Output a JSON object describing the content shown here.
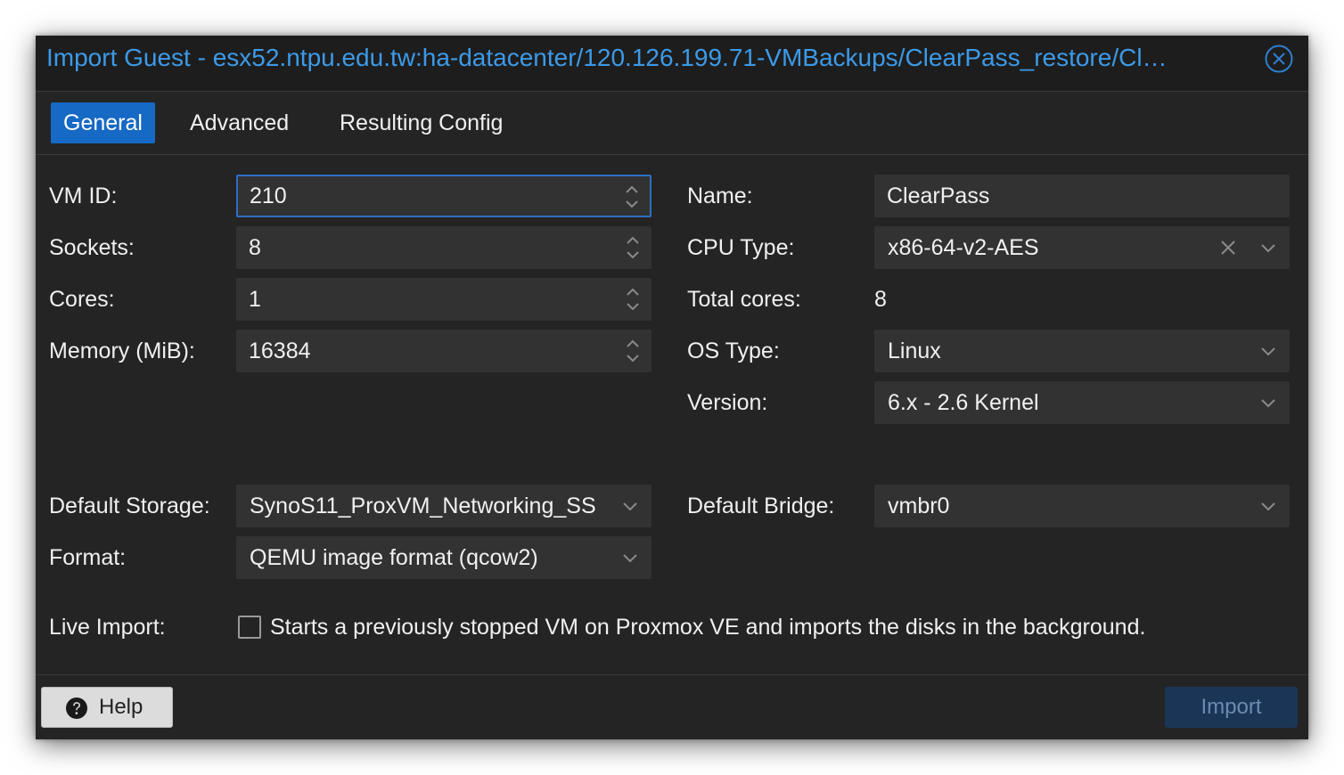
{
  "window": {
    "title": "Import Guest - esx52.ntpu.edu.tw:ha-datacenter/120.126.199.71-VMBackups/ClearPass_restore/Cl…",
    "close_icon": "close-circle-icon",
    "accent_color": "#3c9ae8"
  },
  "tabs": [
    {
      "label": "General",
      "active": true
    },
    {
      "label": "Advanced",
      "active": false
    },
    {
      "label": "Resulting Config",
      "active": false
    }
  ],
  "form": {
    "vm_id": {
      "label": "VM ID:",
      "value": "210"
    },
    "sockets": {
      "label": "Sockets:",
      "value": "8"
    },
    "cores": {
      "label": "Cores:",
      "value": "1"
    },
    "memory": {
      "label": "Memory (MiB):",
      "value": "16384"
    },
    "name": {
      "label": "Name:",
      "value": "ClearPass"
    },
    "cpu_type": {
      "label": "CPU Type:",
      "value": "x86-64-v2-AES"
    },
    "total_cores": {
      "label": "Total cores:",
      "value": "8"
    },
    "os_type": {
      "label": "OS Type:",
      "value": "Linux"
    },
    "version": {
      "label": "Version:",
      "value": "6.x - 2.6 Kernel"
    },
    "default_storage": {
      "label": "Default Storage:",
      "value": "SynoS11_ProxVM_Networking_SS"
    },
    "default_bridge": {
      "label": "Default Bridge:",
      "value": "vmbr0"
    },
    "format": {
      "label": "Format:",
      "value": "QEMU image format (qcow2)"
    },
    "live_import": {
      "label": "Live Import:",
      "checked": false,
      "description": "Starts a previously stopped VM on Proxmox VE and imports the disks in the background."
    }
  },
  "footer": {
    "help_label": "Help",
    "help_icon": "question-circle-icon",
    "import_label": "Import",
    "import_enabled": false
  }
}
